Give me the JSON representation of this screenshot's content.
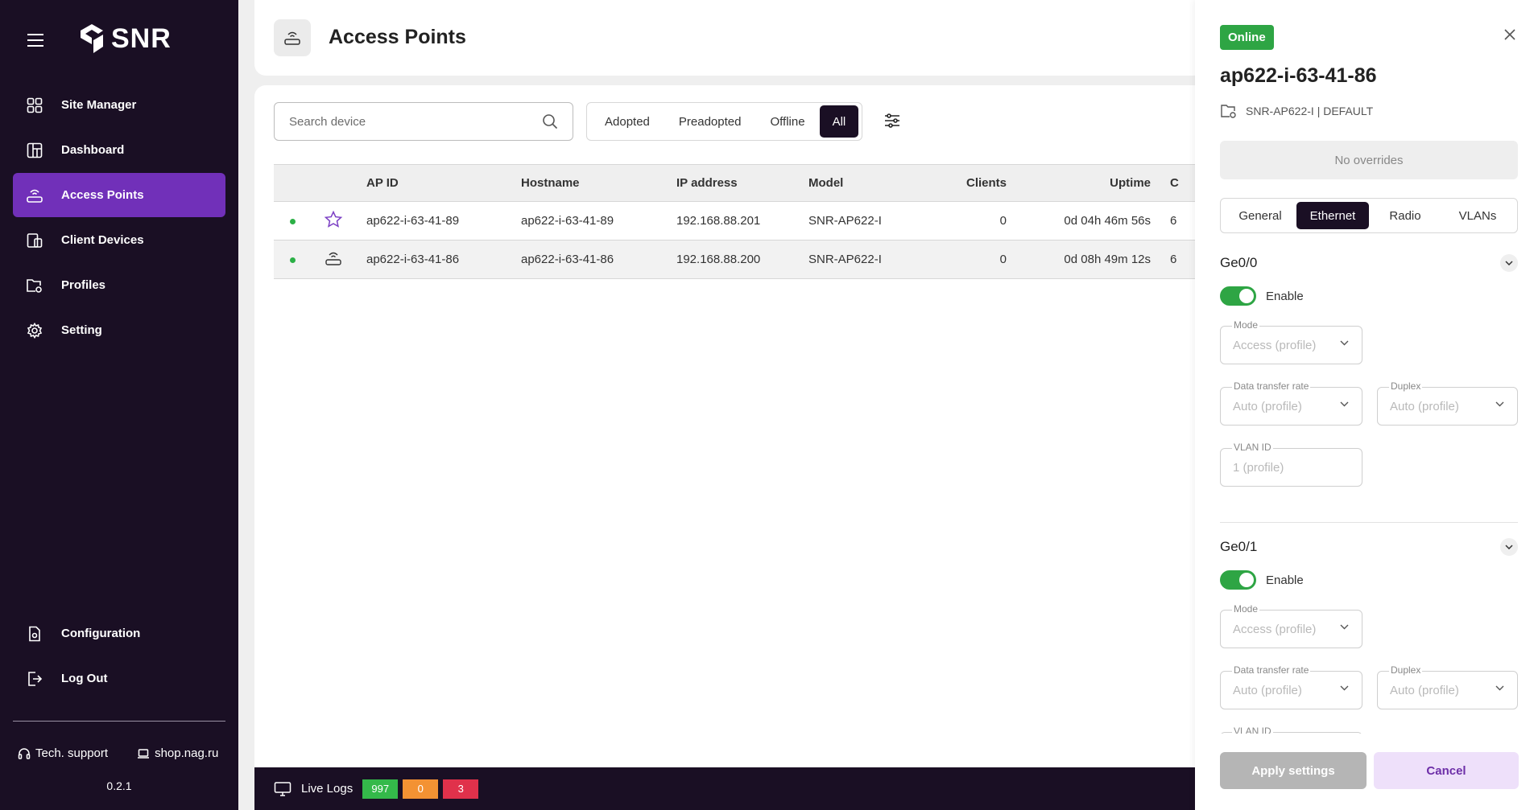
{
  "brand": {
    "logo_text": "SNR"
  },
  "sidebar": {
    "items": [
      {
        "label": "Site Manager",
        "icon": "grid-icon"
      },
      {
        "label": "Dashboard",
        "icon": "dashboard-icon"
      },
      {
        "label": "Access Points",
        "icon": "access-point-icon",
        "active": true
      },
      {
        "label": "Client Devices",
        "icon": "devices-icon"
      },
      {
        "label": "Profiles",
        "icon": "folder-settings-icon"
      },
      {
        "label": "Setting",
        "icon": "gear-icon"
      }
    ],
    "bottom_items": [
      {
        "label": "Configuration",
        "icon": "file-settings-icon"
      },
      {
        "label": "Log Out",
        "icon": "logout-icon"
      }
    ],
    "support_label": "Tech. support",
    "shop_label": "shop.nag.ru",
    "version": "0.2.1"
  },
  "header": {
    "title": "Access Points"
  },
  "toolbar": {
    "search_placeholder": "Search device",
    "filters": [
      "Adopted",
      "Preadopted",
      "Offline",
      "All"
    ],
    "active_filter": "All"
  },
  "table": {
    "columns": [
      "",
      "",
      "AP ID",
      "Hostname",
      "IP address",
      "Model",
      "Clients",
      "Uptime",
      "C"
    ],
    "rows": [
      {
        "status": "online",
        "icon": "star-icon",
        "ap_id": "ap622-i-63-41-89",
        "hostname": "ap622-i-63-41-89",
        "ip": "192.168.88.201",
        "model": "SNR-AP622-I",
        "clients": "0",
        "uptime": "0d 04h 46m 56s",
        "extra": "6"
      },
      {
        "status": "online",
        "icon": "access-point-icon",
        "ap_id": "ap622-i-63-41-86",
        "hostname": "ap622-i-63-41-86",
        "ip": "192.168.88.200",
        "model": "SNR-AP622-I",
        "clients": "0",
        "uptime": "0d 08h 49m 12s",
        "extra": "6",
        "selected": true
      }
    ]
  },
  "livelogs": {
    "label": "Live Logs",
    "counts": [
      {
        "value": "997",
        "color": "#34b94a"
      },
      {
        "value": "0",
        "color": "#f39233"
      },
      {
        "value": "3",
        "color": "#e0314b"
      }
    ]
  },
  "panel": {
    "status": "Online",
    "device_name": "ap622-i-63-41-86",
    "model_line": "SNR-AP622-I | DEFAULT",
    "overrides": "No overrides",
    "tabs": [
      "General",
      "Ethernet",
      "Radio",
      "VLANs"
    ],
    "active_tab": "Ethernet",
    "ports": [
      {
        "name": "Ge0/0",
        "enable_label": "Enable",
        "enabled": true,
        "mode_label": "Mode",
        "mode_value": "Access (profile)",
        "rate_label": "Data transfer rate",
        "rate_value": "Auto (profile)",
        "duplex_label": "Duplex",
        "duplex_value": "Auto (profile)",
        "vlan_label": "VLAN ID",
        "vlan_value": "1 (profile)"
      },
      {
        "name": "Ge0/1",
        "enable_label": "Enable",
        "enabled": true,
        "mode_label": "Mode",
        "mode_value": "Access (profile)",
        "rate_label": "Data transfer rate",
        "rate_value": "Auto (profile)",
        "duplex_label": "Duplex",
        "duplex_value": "Auto (profile)",
        "vlan_label": "VLAN ID"
      }
    ],
    "apply_label": "Apply settings",
    "cancel_label": "Cancel"
  },
  "colors": {
    "sidebar_bg": "#1a0f24",
    "accent": "#7130b9",
    "online": "#2ea544"
  }
}
